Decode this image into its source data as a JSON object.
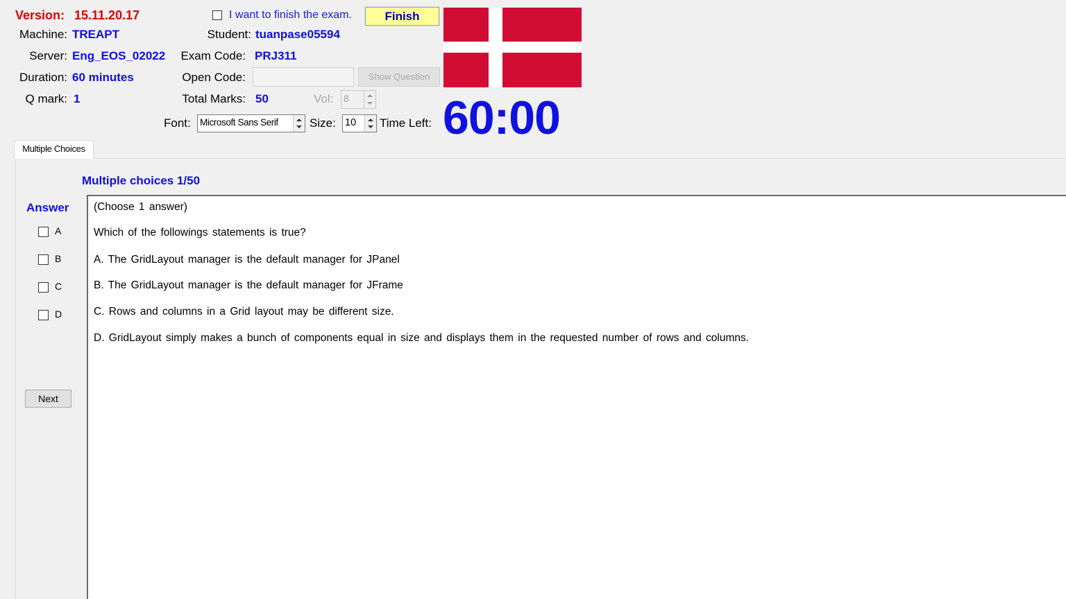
{
  "header": {
    "version_label": "Version:",
    "version_value": "15.11.20.17",
    "machine_label": "Machine:",
    "machine_value": "TREAPT",
    "server_label": "Server:",
    "server_value": "Eng_EOS_02022",
    "duration_label": "Duration:",
    "duration_value": "60 minutes",
    "qmark_label": "Q mark:",
    "qmark_value": "1",
    "finish_check_label": "I want to finish the exam.",
    "finish_button": "Finish",
    "student_label": "Student:",
    "student_value": "tuanpase05594",
    "exam_code_label": "Exam Code:",
    "exam_code_value": "PRJ311",
    "open_code_label": "Open Code:",
    "open_code_value": "",
    "show_question_button": "Show Question",
    "total_marks_label": "Total Marks:",
    "total_marks_value": "50",
    "vol_label": "Vol:",
    "vol_value": "8",
    "font_label": "Font:",
    "font_value": "Microsoft Sans Serif",
    "size_label": "Size:",
    "size_value": "10",
    "time_left_label": "Time Left:",
    "timer_value": "60:00"
  },
  "colors": {
    "accent_blue": "#1010e0",
    "version_red": "#e00000",
    "finish_bg": "#ffff99",
    "flag_red": "#d10d33"
  },
  "tab": {
    "label": "Multiple Choices"
  },
  "question": {
    "heading": "Multiple choices 1/50",
    "answer_label": "Answer",
    "instruction": "(Choose 1 answer)",
    "text": "Which of the followings statements is true?",
    "options": [
      "A.  The GridLayout manager is the default manager for  JPanel",
      "B.  The GridLayout manager is the default manager for  JFrame",
      "C.  Rows and columns in a Grid layout may be  different size.",
      "D.  GridLayout simply makes a bunch of components equal in size and displays them in the requested number of rows and columns."
    ],
    "answer_choices": [
      "A",
      "B",
      "C",
      "D"
    ],
    "next_button": "Next"
  }
}
